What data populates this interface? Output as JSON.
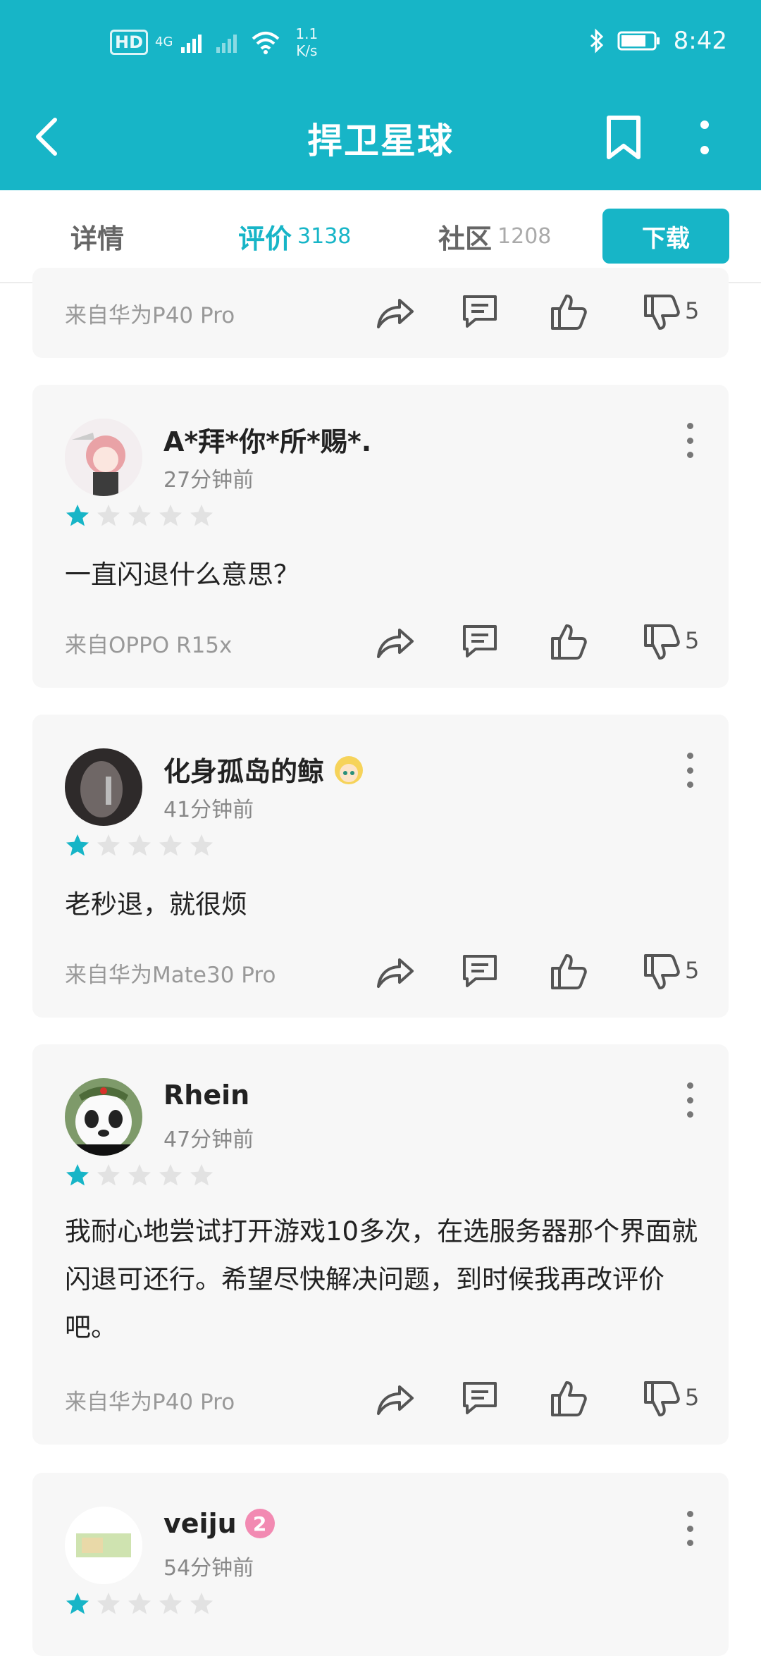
{
  "status_bar": {
    "hd_label": "HD",
    "network_label": "4G",
    "speed_value": "1.1",
    "speed_unit": "K/s",
    "time": "8:42"
  },
  "app_bar": {
    "title": "捍卫星球",
    "color": "#17b5c7"
  },
  "tabs": [
    {
      "label": "详情",
      "count": ""
    },
    {
      "label": "评价",
      "count": "3138"
    },
    {
      "label": "社区",
      "count": "1208"
    }
  ],
  "download_label": "下载",
  "partial_review": {
    "device": "来自华为P40 Pro",
    "dislike_count": "5"
  },
  "reviews": [
    {
      "name": "A*拜*你*所*赐*.",
      "time": "27分钟前",
      "rating": 1,
      "text": "一直闪退什么意思？",
      "device": "来自OPPO R15x",
      "dislike_count": "5"
    },
    {
      "name": "化身孤岛的鲸",
      "time": "41分钟前",
      "rating": 1,
      "text": "老秒退，就很烦",
      "device": "来自华为Mate30 Pro",
      "dislike_count": "5"
    },
    {
      "name": "Rhein",
      "time": "47分钟前",
      "rating": 1,
      "text": "我耐心地尝试打开游戏10多次，在选服务器那个界面就闪退可还行。希望尽快解决问题，到时候我再改评价吧。",
      "device": "来自华为P40 Pro",
      "dislike_count": "5"
    },
    {
      "name": "veiju",
      "time": "54分钟前",
      "rating": 1,
      "level": "2"
    }
  ]
}
